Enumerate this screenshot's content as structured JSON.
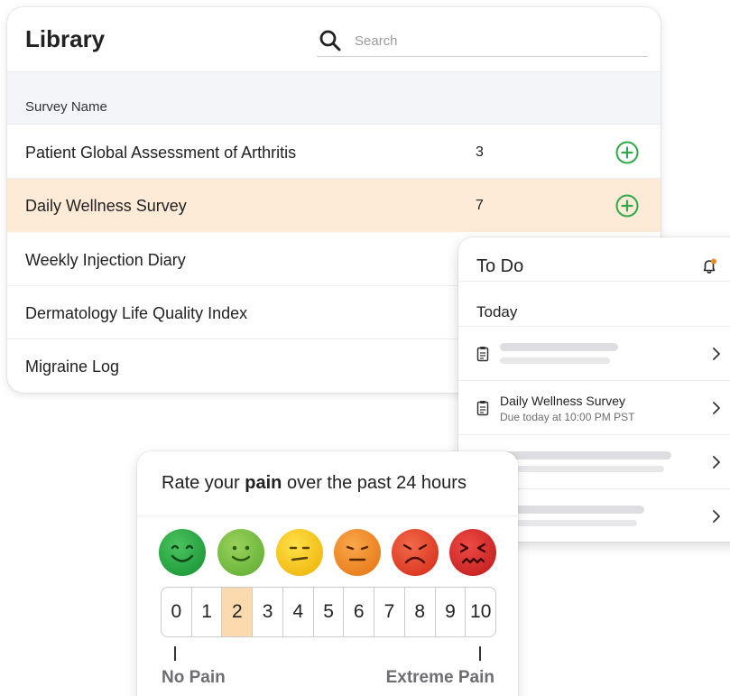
{
  "library": {
    "title": "Library",
    "search_placeholder": "Search",
    "column_header": "Survey Name",
    "rows": [
      {
        "name": "Patient Global Assessment of Arthritis",
        "count": "3",
        "highlighted": false
      },
      {
        "name": "Daily Wellness Survey",
        "count": "7",
        "highlighted": true
      },
      {
        "name": "Weekly Injection Diary",
        "count": "",
        "highlighted": false
      },
      {
        "name": "Dermatology Life Quality Index",
        "count": "",
        "highlighted": false
      },
      {
        "name": "Migraine Log",
        "count": "",
        "highlighted": false
      }
    ],
    "add_icon": "plus-circle-icon"
  },
  "todo": {
    "title": "To Do",
    "section": "Today",
    "items": [
      {
        "placeholder": true
      },
      {
        "placeholder": false,
        "name": "Daily Wellness Survey",
        "due": "Due today at 10:00 PM PST"
      },
      {
        "placeholder": true
      },
      {
        "placeholder": true
      }
    ],
    "icons": {
      "notification": "bell-icon",
      "item": "clipboard-icon",
      "open": "chevron-right-icon"
    }
  },
  "pain": {
    "question_prefix": "Rate your ",
    "question_bold": "pain",
    "question_suffix": " over the past 24 hours",
    "scale": [
      "0",
      "1",
      "2",
      "3",
      "4",
      "5",
      "6",
      "7",
      "8",
      "9",
      "10"
    ],
    "selected": "2",
    "min_label": "No Pain",
    "max_label": "Extreme Pain",
    "faces": [
      {
        "icon": "very-happy-face-icon",
        "color": "#27a844"
      },
      {
        "icon": "happy-face-icon",
        "color": "#7ac142"
      },
      {
        "icon": "neutral-face-icon",
        "color": "#f5c518"
      },
      {
        "icon": "sad-face-icon",
        "color": "#f08a24"
      },
      {
        "icon": "very-sad-face-icon",
        "color": "#e5452e"
      },
      {
        "icon": "worst-pain-face-icon",
        "color": "#d92d2d"
      }
    ]
  },
  "colors": {
    "accent_green": "#2eaa4a",
    "highlight_row": "#fdebd8",
    "selected_cell": "#fdd9b0",
    "notification_dot": "#f08a24"
  }
}
